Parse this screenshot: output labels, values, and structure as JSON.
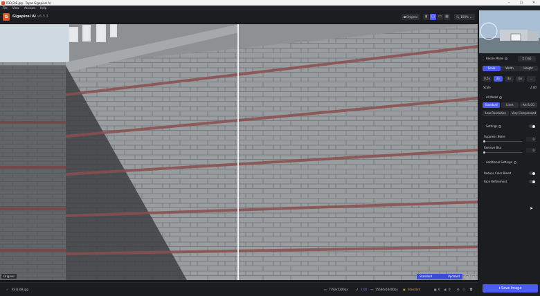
{
  "window": {
    "title": "R33(3)B.jpg - Topaz Gigapixel AI",
    "minimize": "–",
    "maximize": "□",
    "close": "✕"
  },
  "menu": [
    "File",
    "View",
    "Account",
    "Help"
  ],
  "app": {
    "name": "Gigapixel AI",
    "version": "v6.3.3"
  },
  "toolbar": {
    "original_label": "Original",
    "zoom": "100%"
  },
  "canvas": {
    "original_tag": "Original",
    "model_label": "Standard",
    "status": "Updated"
  },
  "statusbar": {
    "filename": "R33(3)B.jpg",
    "input_size": "7792x5200px",
    "scale": "2.00",
    "output_size": "15584x10400px",
    "model": "Standard",
    "count1": "0",
    "count2": "0"
  },
  "panel": {
    "resize_mode": {
      "title": "Resize Mode",
      "crop": "Crop",
      "tabs": [
        "Scale",
        "Width",
        "Height"
      ],
      "scales": [
        "0.5x",
        "2x",
        "4x",
        "6x",
        "..."
      ],
      "scale_label": "Scale",
      "scale_value": "2.00"
    },
    "ai_model": {
      "title": "AI Model",
      "row1": [
        "Standard",
        "Lines",
        "Art & CG"
      ],
      "row2": [
        "Low Resolution",
        "Very Compressed"
      ]
    },
    "settings": {
      "title": "Settings",
      "suppress_noise": "Suppress Noise",
      "suppress_noise_value": "0",
      "remove_blur": "Remove Blur",
      "remove_blur_value": "0"
    },
    "additional": {
      "title": "Additional Settings",
      "reduce_color_bleed": "Reduce Color Bleed",
      "face_refinement": "Face Refinement"
    },
    "save": "Save Image"
  },
  "colors": {
    "accent": "#4c5cf0",
    "brand": "#d8552a"
  }
}
